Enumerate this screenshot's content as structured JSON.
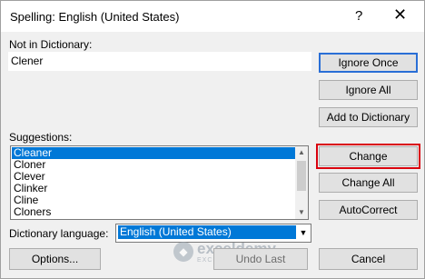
{
  "window": {
    "title": "Spelling: English (United States)",
    "help": "?",
    "close": "✕"
  },
  "not_in_dictionary": {
    "label": "Not in Dictionary:",
    "value": "Clener"
  },
  "suggestions": {
    "label": "Suggestions:",
    "items": [
      "Cleaner",
      "Cloner",
      "Clever",
      "Clinker",
      "Cline",
      "Cloners"
    ],
    "selected_index": 0
  },
  "buttons": {
    "ignore_once": "Ignore Once",
    "ignore_all": "Ignore All",
    "add_to_dictionary": "Add to Dictionary",
    "change": "Change",
    "change_all": "Change All",
    "autocorrect": "AutoCorrect",
    "options": "Options...",
    "undo_last": "Undo Last",
    "cancel": "Cancel"
  },
  "dictionary_language": {
    "label": "Dictionary language:",
    "value": "English (United States)"
  },
  "watermark": {
    "name": "exceldemy",
    "tagline": "EXCEL · DATA · BI"
  },
  "colors": {
    "selection": "#0078d7",
    "highlight": "#d9000d",
    "default_button_border": "#2a6fd6"
  }
}
